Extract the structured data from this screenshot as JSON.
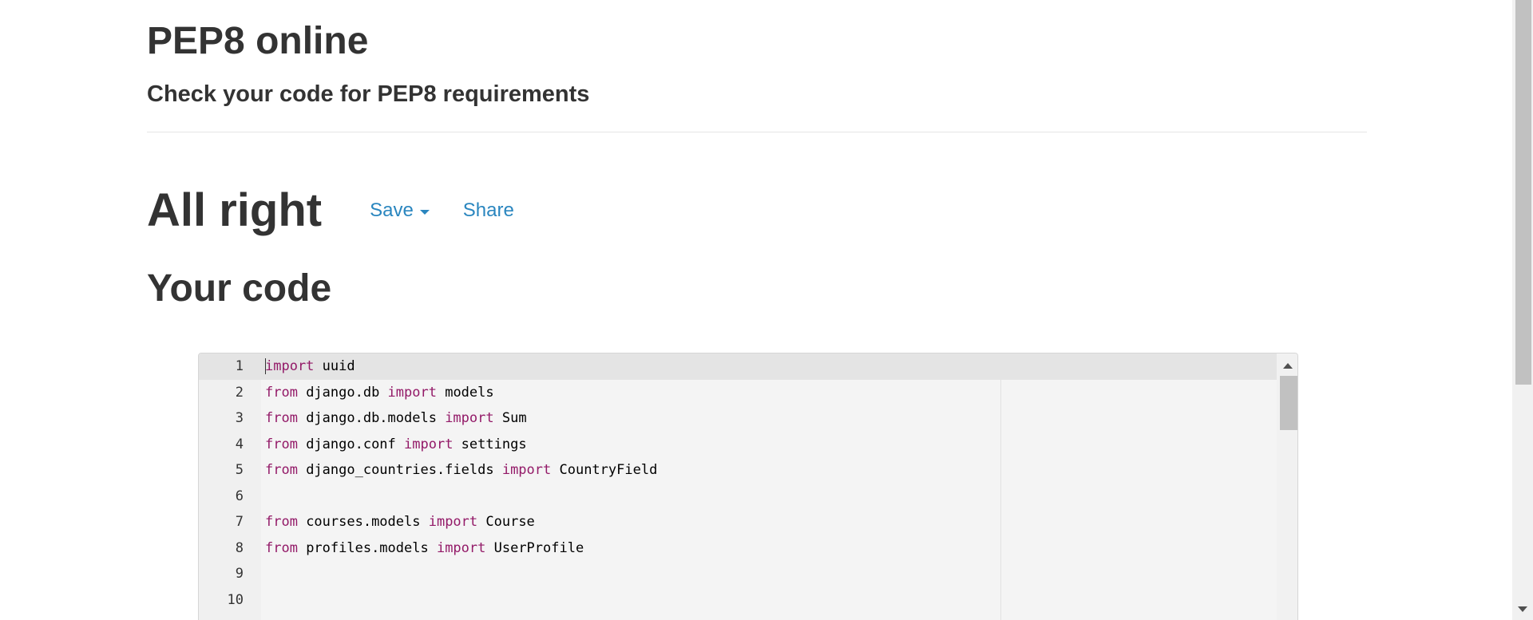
{
  "header": {
    "title": "PEP8 online",
    "subtitle": "Check your code for PEP8 requirements"
  },
  "result": {
    "status": "All right",
    "save_label": "Save",
    "share_label": "Share"
  },
  "code_section": {
    "title": "Your code"
  },
  "editor": {
    "active_line": 1,
    "lines": [
      {
        "num": "1",
        "tokens": [
          {
            "t": "kw",
            "v": "import"
          },
          {
            "t": "txt",
            "v": " uuid"
          }
        ]
      },
      {
        "num": "2",
        "tokens": [
          {
            "t": "kw",
            "v": "from"
          },
          {
            "t": "txt",
            "v": " django.db "
          },
          {
            "t": "kw",
            "v": "import"
          },
          {
            "t": "txt",
            "v": " models"
          }
        ]
      },
      {
        "num": "3",
        "tokens": [
          {
            "t": "kw",
            "v": "from"
          },
          {
            "t": "txt",
            "v": " django.db.models "
          },
          {
            "t": "kw",
            "v": "import"
          },
          {
            "t": "txt",
            "v": " Sum"
          }
        ]
      },
      {
        "num": "4",
        "tokens": [
          {
            "t": "kw",
            "v": "from"
          },
          {
            "t": "txt",
            "v": " django.conf "
          },
          {
            "t": "kw",
            "v": "import"
          },
          {
            "t": "txt",
            "v": " settings"
          }
        ]
      },
      {
        "num": "5",
        "tokens": [
          {
            "t": "kw",
            "v": "from"
          },
          {
            "t": "txt",
            "v": " django_countries.fields "
          },
          {
            "t": "kw",
            "v": "import"
          },
          {
            "t": "txt",
            "v": " CountryField"
          }
        ]
      },
      {
        "num": "6",
        "tokens": []
      },
      {
        "num": "7",
        "tokens": [
          {
            "t": "kw",
            "v": "from"
          },
          {
            "t": "txt",
            "v": " courses.models "
          },
          {
            "t": "kw",
            "v": "import"
          },
          {
            "t": "txt",
            "v": " Course"
          }
        ]
      },
      {
        "num": "8",
        "tokens": [
          {
            "t": "kw",
            "v": "from"
          },
          {
            "t": "txt",
            "v": " profiles.models "
          },
          {
            "t": "kw",
            "v": "import"
          },
          {
            "t": "txt",
            "v": " UserProfile"
          }
        ]
      },
      {
        "num": "9",
        "tokens": []
      },
      {
        "num": "10",
        "tokens": []
      }
    ]
  },
  "icons": {
    "save_dropdown": "caret-down-icon",
    "scroll_up": "arrow-up-icon",
    "scroll_down": "arrow-down-icon"
  },
  "colors": {
    "keyword": "#931a68",
    "link": "#2a86bf",
    "text": "#333333"
  }
}
